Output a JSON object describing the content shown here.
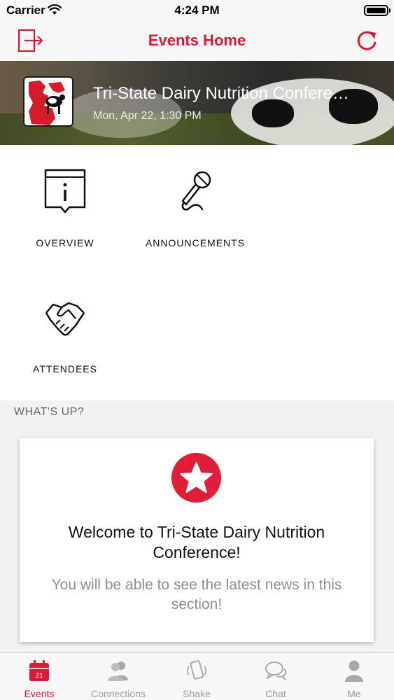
{
  "status_bar": {
    "carrier": "Carrier",
    "time": "4:24 PM"
  },
  "nav": {
    "title": "Events Home",
    "left_icon": "exit-icon",
    "right_icon": "refresh-icon"
  },
  "event": {
    "title": "Tri-State Dairy Nutrition Confere…",
    "date": "Mon, Apr 22, 1:30 PM"
  },
  "features": [
    {
      "label": "OVERVIEW",
      "icon": "info-icon"
    },
    {
      "label": "ANNOUNCEMENTS",
      "icon": "microphone-icon"
    },
    {
      "label": "ATTENDEES",
      "icon": "handshake-icon"
    }
  ],
  "whats_up": {
    "header": "WHAT'S UP?",
    "card": {
      "title": "Welcome to Tri-State Dairy Nutrition Conference!",
      "body": "You will be able to see the latest news in this section!",
      "icon": "star-icon"
    }
  },
  "tabs": [
    {
      "label": "Events",
      "icon": "calendar-icon",
      "badge": "21",
      "active": true
    },
    {
      "label": "Connections",
      "icon": "people-icon",
      "active": false
    },
    {
      "label": "Shake",
      "icon": "shake-phone-icon",
      "active": false
    },
    {
      "label": "Chat",
      "icon": "chat-icon",
      "active": false
    },
    {
      "label": "Me",
      "icon": "person-icon",
      "active": false
    }
  ],
  "colors": {
    "accent": "#d91a35",
    "inactive_tab": "#9a9a9a"
  }
}
